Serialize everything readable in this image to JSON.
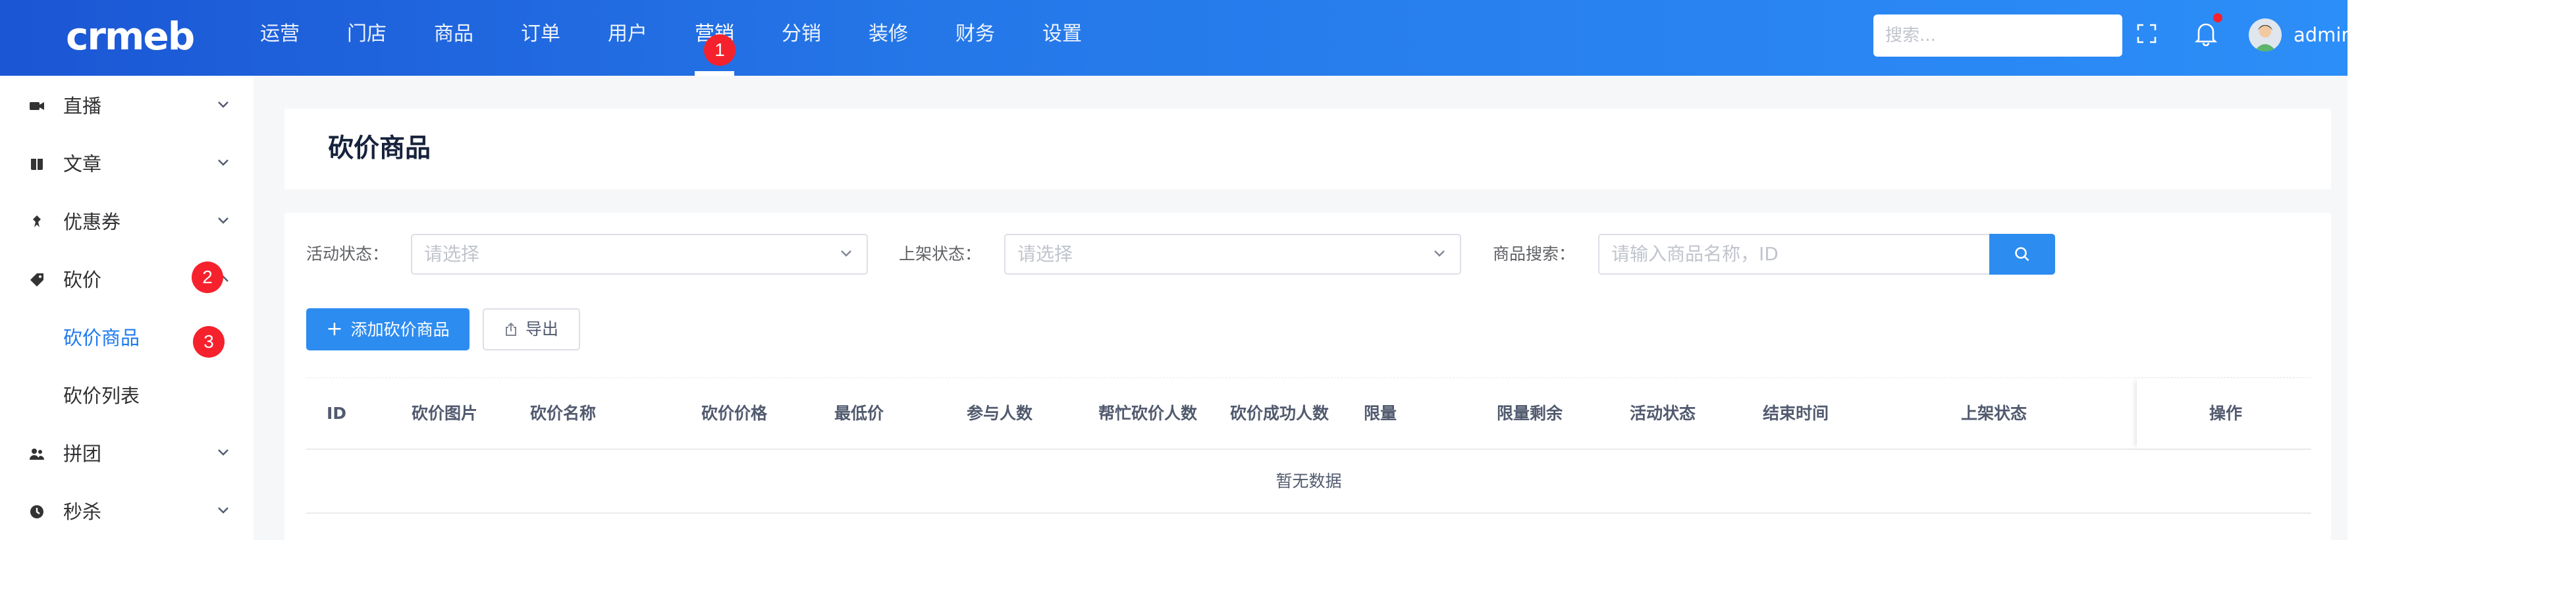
{
  "header": {
    "logo_text": "crmeb",
    "nav": [
      {
        "label": "运营"
      },
      {
        "label": "门店"
      },
      {
        "label": "商品"
      },
      {
        "label": "订单"
      },
      {
        "label": "用户"
      },
      {
        "label": "营销",
        "active": true
      },
      {
        "label": "分销"
      },
      {
        "label": "装修"
      },
      {
        "label": "财务"
      },
      {
        "label": "设置"
      }
    ],
    "search_placeholder": "搜索...",
    "username": "admin"
  },
  "badges": {
    "nav": "1",
    "sidebar": "2",
    "submenu": "3"
  },
  "sidebar": {
    "items": [
      {
        "label": "直播",
        "icon": "video-icon"
      },
      {
        "label": "文章",
        "icon": "book-icon"
      },
      {
        "label": "优惠券",
        "icon": "coupon-icon"
      },
      {
        "label": "砍价",
        "icon": "tag-icon",
        "expanded": true
      },
      {
        "label": "拼团",
        "icon": "group-icon"
      },
      {
        "label": "秒杀",
        "icon": "clock-icon"
      }
    ],
    "sub_items": [
      {
        "label": "砍价商品",
        "active": true
      },
      {
        "label": "砍价列表"
      }
    ]
  },
  "page": {
    "title": "砍价商品",
    "filters": {
      "status_label": "活动状态：",
      "status_placeholder": "请选择",
      "shelf_label": "上架状态：",
      "shelf_placeholder": "请选择",
      "search_label": "商品搜索：",
      "search_placeholder": "请输入商品名称，ID"
    },
    "buttons": {
      "add": "添加砍价商品",
      "export": "导出"
    },
    "table": {
      "columns": [
        "ID",
        "砍价图片",
        "砍价名称",
        "砍价价格",
        "最低价",
        "参与人数",
        "帮忙砍价人数",
        "砍价成功人数",
        "限量",
        "限量剩余",
        "活动状态",
        "结束时间",
        "上架状态",
        "操作"
      ],
      "empty_text": "暂无数据"
    }
  },
  "colors": {
    "primary": "#2d8cf0",
    "header_start": "#1b56d4",
    "header_end": "#2c8ef8",
    "badge": "#f5222d",
    "active_text": "#1e7af0"
  }
}
